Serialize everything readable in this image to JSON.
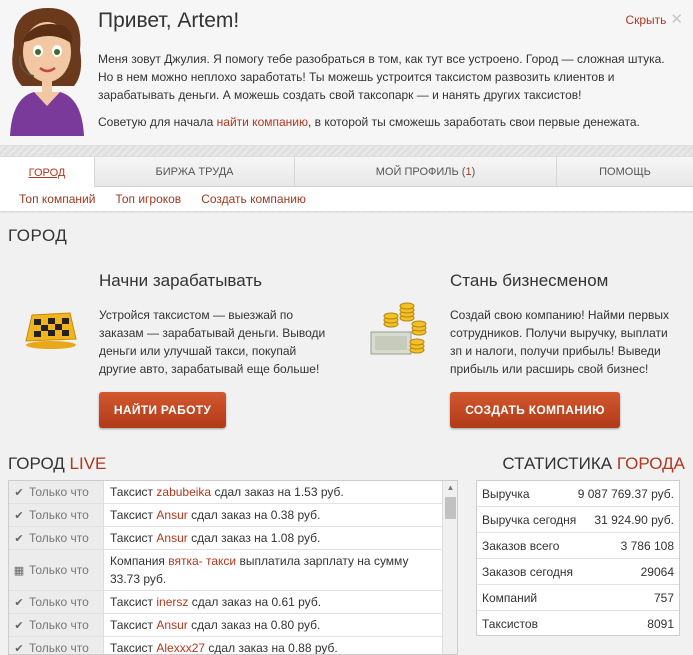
{
  "greeting": {
    "title": "Привет, Artem!",
    "close_label": "Скрыть",
    "text_main": "Меня зовут Джулия. Я помогу тебе разобраться в том, как тут все устроено. Город — сложная штука. Но в нем можно неплохо заработать! Ты можешь устроится таксистом развозить клиентов и зарабатывать деньги. А можешь создать свой таксопарк — и нанять других таксистов!",
    "text_prefix": "Советую для начала ",
    "text_link": "найти компанию",
    "text_suffix": ", в которой ты сможешь заработать свои первые денежата."
  },
  "tabs": [
    {
      "label": "Город"
    },
    {
      "label": "Биржа труда"
    },
    {
      "label_prefix": "Мой профиль (",
      "count": "1",
      "label_suffix": ")"
    },
    {
      "label": "Помощь"
    }
  ],
  "subnav": [
    "Топ компаний",
    "Топ игроков",
    "Создать компанию"
  ],
  "section_title": "ГОРОД",
  "promo_left": {
    "title": "Начни зарабатывать",
    "text": "Устройся таксистом — выезжай по заказам — зарабатывай деньги. Выводи деньги или улучшай такси, покупай другие авто, зарабатывай еще больше!",
    "button": "НАЙТИ РАБОТУ"
  },
  "promo_right": {
    "title": "Стань бизнесменом",
    "text": "Создай свою компанию! Найми первых сотрудников. Получи выручку, выплати зп и налоги, получи прибыль! Выведи прибыль или расширь свой бизнес!",
    "button": "СОЗДАТЬ КОМПАНИЮ"
  },
  "live": {
    "title_main": "ГОРОД ",
    "title_accent": "LIVE",
    "rows": [
      {
        "icon": "check-icon",
        "when": "Только что",
        "pre": "Таксист ",
        "name": "zabubeika",
        "post": " сдал заказ на 1.53 руб."
      },
      {
        "icon": "check-icon",
        "when": "Только что",
        "pre": "Таксист ",
        "name": "Ansur",
        "post": " сдал заказ на 0.38 руб."
      },
      {
        "icon": "check-icon",
        "when": "Только что",
        "pre": "Таксист ",
        "name": "Ansur",
        "post": " сдал заказ на 1.08 руб."
      },
      {
        "icon": "calendar-icon",
        "when": "Только что",
        "pre": "Компания ",
        "name": "вятка- такси",
        "post": " выплатила зарплату на сумму 33.73 руб."
      },
      {
        "icon": "check-icon",
        "when": "Только что",
        "pre": "Таксист ",
        "name": "inersz",
        "post": " сдал заказ на 0.61 руб."
      },
      {
        "icon": "check-icon",
        "when": "Только что",
        "pre": "Таксист ",
        "name": "Ansur",
        "post": " сдал заказ на 0.80 руб."
      },
      {
        "icon": "check-icon",
        "when": "Только что",
        "pre": "Таксист ",
        "name": "Alexxx27",
        "post": " сдал заказ на 0.88 руб."
      }
    ]
  },
  "stats": {
    "title_main": "СТАТИСТИКА ",
    "title_accent": "ГОРОДА",
    "rows": [
      {
        "label": "Выручка",
        "value": "9 087 769.37 руб."
      },
      {
        "label": "Выручка сегодня",
        "value": "31 924.90 руб."
      },
      {
        "label": "Заказов всего",
        "value": "3 786 108"
      },
      {
        "label": "Заказов сегодня",
        "value": "29064"
      },
      {
        "label": "Компаний",
        "value": "757"
      },
      {
        "label": "Таксистов",
        "value": "8091"
      }
    ]
  },
  "colors": {
    "accent": "#b0381e",
    "button": "#c24a24"
  }
}
